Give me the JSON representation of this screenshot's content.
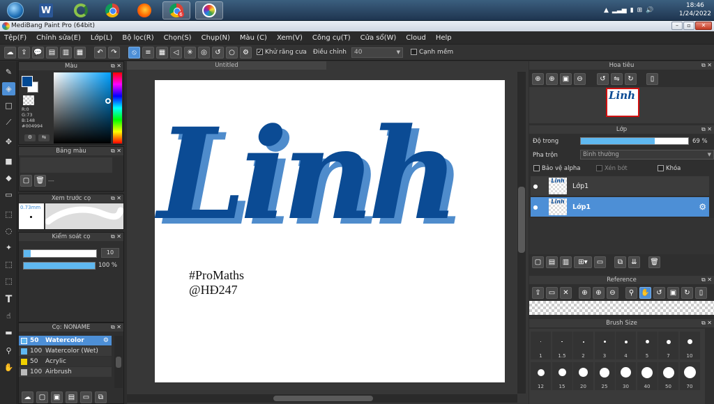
{
  "taskbar": {
    "clock_time": "18:46",
    "clock_date": "1/24/2022",
    "chrome_badge": "6"
  },
  "window": {
    "title": "MediBang Paint Pro (64bit)"
  },
  "menu": [
    "Tệp(F)",
    "Chỉnh sửa(E)",
    "Lớp(L)",
    "Bộ lọc(R)",
    "Chọn(S)",
    "Chụp(N)",
    "Màu (C)",
    "Xem(V)",
    "Công cụ(T)",
    "Cửa sổ(W)",
    "Cloud",
    "Help"
  ],
  "toolbar": {
    "antialias_label": "Khử răng cưa",
    "adjust_label": "Điều chỉnh",
    "adjust_value": "40",
    "soft_edge_label": "Cạnh mềm"
  },
  "color_panel": {
    "title": "Màu",
    "r": "R:0",
    "g": "G:73",
    "b": "B:148",
    "hex": "#004994",
    "primary_color": "#004994"
  },
  "palette_panel": {
    "title": "Bảng màu",
    "empty": "---"
  },
  "brush_preview": {
    "title": "Xem trước cọ",
    "size": "0.73mm"
  },
  "brush_control": {
    "title": "Kiểm soát cọ",
    "size_value": "10",
    "size_fraction": 0.1,
    "opacity_value": "100 %",
    "opacity_fraction": 1.0
  },
  "brush_panel": {
    "title": "Cọ: NONAME",
    "items": [
      {
        "size": "50",
        "name": "Watercolor",
        "color": "#5fb8f0",
        "selected": true
      },
      {
        "size": "100",
        "name": "Watercolor (Wet)",
        "color": "#5fb8f0",
        "selected": false
      },
      {
        "size": "50",
        "name": "Acrylic",
        "color": "#f0d000",
        "selected": false
      },
      {
        "size": "100",
        "name": "Airbrush",
        "color": "#bbbbbb",
        "selected": false
      }
    ]
  },
  "document": {
    "tab": "Untitled",
    "artwork_text": "Linh",
    "caption_1": "#ProMaths",
    "caption_2": "@HĐ247"
  },
  "navigator": {
    "title": "Hoa tiêu"
  },
  "layer_panel": {
    "title": "Lớp",
    "opacity_label": "Độ trong",
    "opacity_value": "69 %",
    "opacity_fraction": 0.69,
    "blend_label": "Pha trộn",
    "blend_value": "Bình thường",
    "protect_alpha": "Bảo vệ alpha",
    "clipping": "Xén bớt",
    "lock": "Khóa",
    "layers": [
      {
        "name": "Lớp1",
        "selected": false
      },
      {
        "name": "Lớp1",
        "selected": true
      }
    ]
  },
  "reference_panel": {
    "title": "Reference"
  },
  "brush_size_panel": {
    "title": "Brush Size",
    "sizes": [
      "1",
      "1.5",
      "2",
      "3",
      "4",
      "5",
      "7",
      "10",
      "12",
      "15",
      "20",
      "25",
      "30",
      "40",
      "50",
      "70"
    ]
  }
}
